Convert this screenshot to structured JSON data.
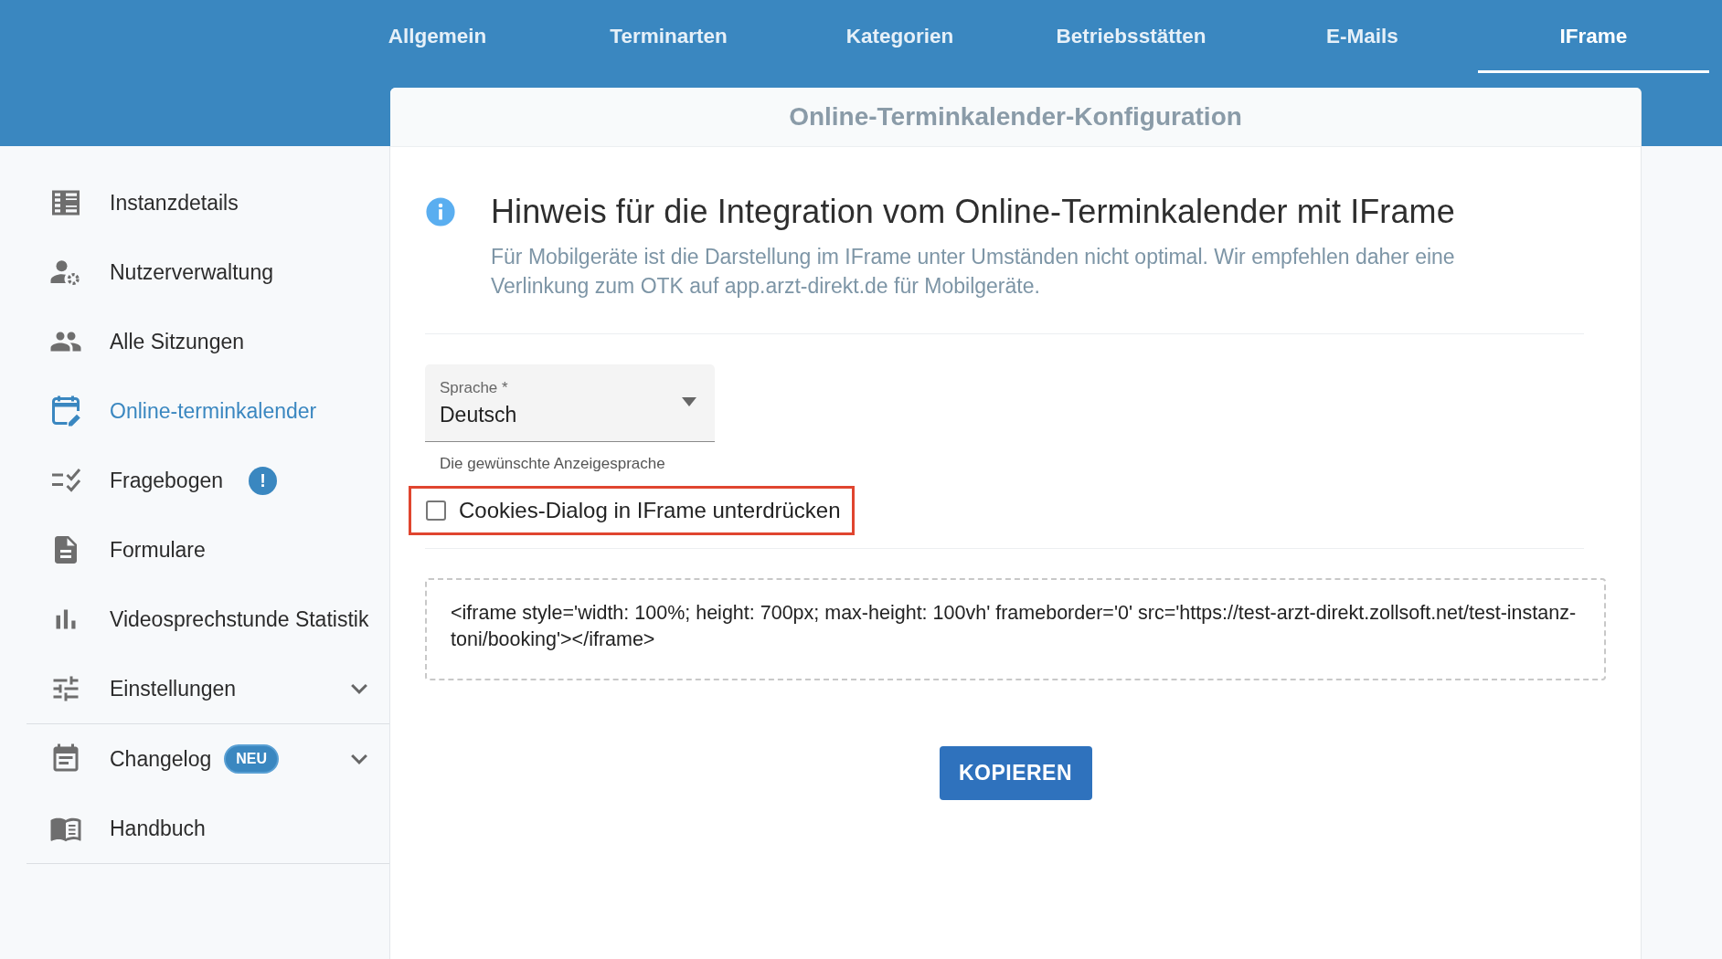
{
  "tabs": [
    {
      "label": "Allgemein",
      "selected": false
    },
    {
      "label": "Terminarten",
      "selected": false
    },
    {
      "label": "Kategorien",
      "selected": false
    },
    {
      "label": "Betriebsstätten",
      "selected": false
    },
    {
      "label": "E-Mails",
      "selected": false
    },
    {
      "label": "IFrame",
      "selected": true
    }
  ],
  "sidebar": {
    "sections": [
      [
        {
          "label": "Instanzdetails",
          "selected": false
        },
        {
          "label": "Nutzerverwaltung",
          "selected": false
        },
        {
          "label": "Alle Sitzungen",
          "selected": false
        },
        {
          "label": "Online-terminkalender",
          "selected": true
        },
        {
          "label": "Fragebogen",
          "selected": false,
          "badge": {
            "kind": "alert",
            "text": "!"
          }
        },
        {
          "label": "Formulare",
          "selected": false
        },
        {
          "label": "Videosprechstunde Statistik",
          "selected": false
        },
        {
          "label": "Einstellungen",
          "selected": false,
          "expanded": false
        }
      ],
      [
        {
          "label": "Changelog",
          "selected": false,
          "expanded": false,
          "badge": {
            "kind": "tag",
            "text": "NEU"
          }
        },
        {
          "label": "Handbuch",
          "selected": false
        }
      ]
    ]
  },
  "card": {
    "title": "Online-Terminkalender-Konfiguration",
    "notice": {
      "heading": "Hinweis für die Integration vom Online-Terminkalender mit IFrame",
      "text": "Für Mobilgeräte ist die Darstellung im IFrame unter Umständen nicht optimal. Wir empfehlen daher eine Verlinkung zum OTK auf app.arzt-direkt.de für Mobilgeräte."
    },
    "language_select": {
      "label": "Sprache *",
      "value": "Deutsch",
      "helper": "Die gewünschte Anzeigesprache"
    },
    "checkbox": {
      "label": "Cookies-Dialog in IFrame unterdrücken",
      "checked": false,
      "highlighted": true
    },
    "code_snippet": "<iframe style='width: 100%; height: 700px; max-height: 100vh' frameborder='0' src='https://test-arzt-direkt.zollsoft.net/test-instanz-toni/booking'></iframe>",
    "button": "KOPIEREN"
  }
}
